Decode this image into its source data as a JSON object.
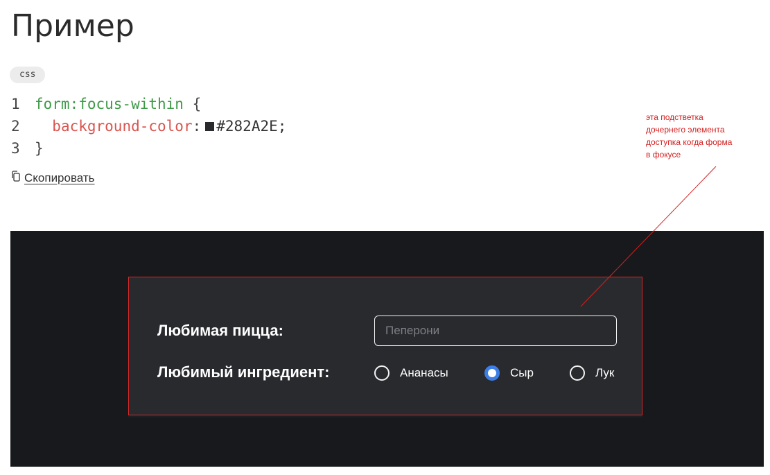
{
  "heading": "Пример",
  "code_block": {
    "language": "css",
    "lines": [
      {
        "num": "1",
        "selector": "form:focus-within",
        "brace_open": "{"
      },
      {
        "num": "2",
        "property": "background-color",
        "colon": ":",
        "value": "#282A2E;"
      },
      {
        "num": "3",
        "brace_close": "}"
      }
    ],
    "swatch_color": "#282A2E"
  },
  "copy_button": {
    "label": "Скопировать",
    "icon": "copy-icon"
  },
  "annotation": {
    "lines": [
      "эта подстветка",
      "дочернего элемента",
      "доступка когда форма",
      "в фокусе"
    ],
    "color": "#d42020"
  },
  "demo": {
    "form": {
      "background": "#282A2E",
      "outline_color": "#d42a2a",
      "pizza_label": "Любимая пицца:",
      "pizza_input_placeholder": "Пеперони",
      "pizza_input_value": "",
      "ingredient_label": "Любимый ингредиент:",
      "options": [
        {
          "label": "Ананасы",
          "checked": false
        },
        {
          "label": "Сыр",
          "checked": true
        },
        {
          "label": "Лук",
          "checked": false
        }
      ]
    }
  }
}
